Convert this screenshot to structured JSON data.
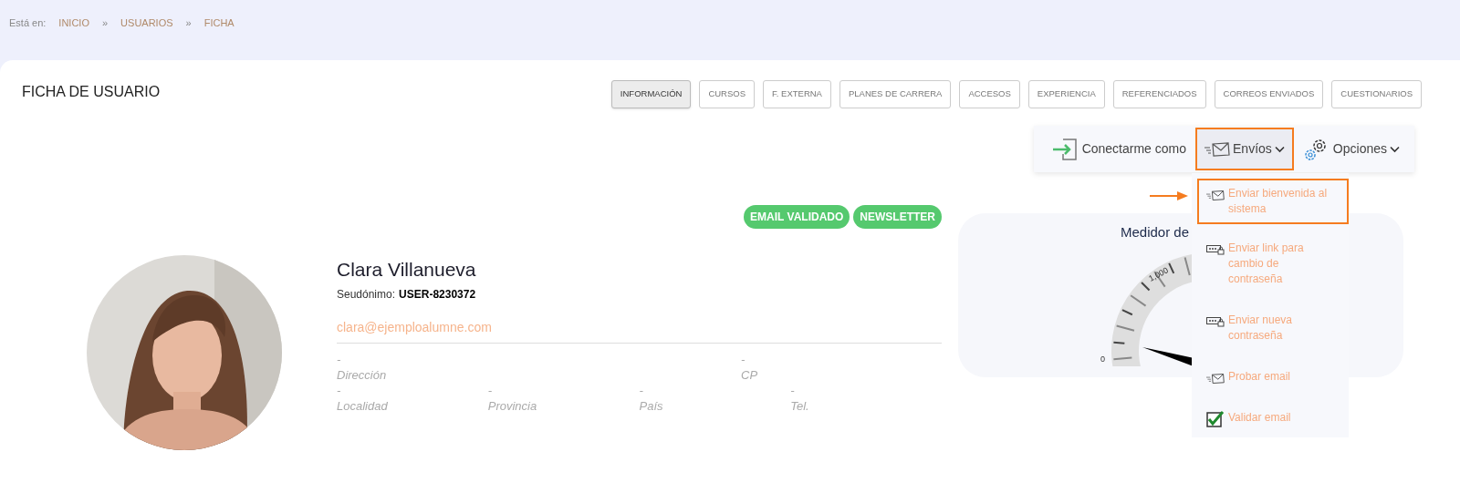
{
  "breadcrumb": {
    "prefix": "Está en:",
    "items": [
      {
        "label": "INICIO"
      },
      {
        "label": "USUARIOS"
      },
      {
        "label": "FICHA"
      }
    ],
    "separator": "»"
  },
  "page_title": "FICHA DE USUARIO",
  "tabs": [
    {
      "label": "INFORMACIÓN",
      "selected": true
    },
    {
      "label": "CURSOS",
      "selected": false
    },
    {
      "label": "F. EXTERNA",
      "selected": false
    },
    {
      "label": "PLANES DE CARRERA",
      "selected": false
    },
    {
      "label": "ACCESOS",
      "selected": false
    },
    {
      "label": "EXPERIENCIA",
      "selected": false
    },
    {
      "label": "REFERENCIADOS",
      "selected": false
    },
    {
      "label": "CORREOS ENVIADOS",
      "selected": false
    },
    {
      "label": "CUESTIONARIOS",
      "selected": false
    }
  ],
  "actions": [
    {
      "kind": "login",
      "label": "Conectarme como",
      "dropdown": false,
      "highlighted": false
    },
    {
      "kind": "mail",
      "label": "Envíos",
      "dropdown": true,
      "highlighted": true
    },
    {
      "kind": "gear",
      "label": "Opciones",
      "dropdown": true,
      "highlighted": false
    }
  ],
  "envios_menu": [
    {
      "kind": "mail",
      "label": "Enviar bienvenida al sistema",
      "highlighted": true
    },
    {
      "kind": "password",
      "label": "Enviar link para cambio de contraseña",
      "highlighted": false
    },
    {
      "kind": "password",
      "label": "Enviar nueva contraseña",
      "highlighted": false
    },
    {
      "kind": "mail",
      "label": "Probar email",
      "highlighted": false
    },
    {
      "kind": "check",
      "label": "Validar email",
      "highlighted": false
    }
  ],
  "badges": [
    {
      "label": "EMAIL VALIDADO"
    },
    {
      "label": "NEWSLETTER"
    }
  ],
  "profile": {
    "name": "Clara Villanueva",
    "alias_label": "Seudónimo:",
    "alias": "USER-8230372",
    "email": "clara@ejemploalumne.com"
  },
  "fields": [
    [
      {
        "value": "-",
        "label": "Dirección"
      },
      {
        "value": "-",
        "label": "CP"
      }
    ],
    [
      {
        "value": "-",
        "label": "Localidad"
      },
      {
        "value": "-",
        "label": "Provincia"
      },
      {
        "value": "-",
        "label": "País"
      },
      {
        "value": "-",
        "label": "Tel."
      }
    ]
  ],
  "meter": {
    "title": "Medidor de",
    "tick_labels": [
      "0",
      "1,000"
    ]
  }
}
